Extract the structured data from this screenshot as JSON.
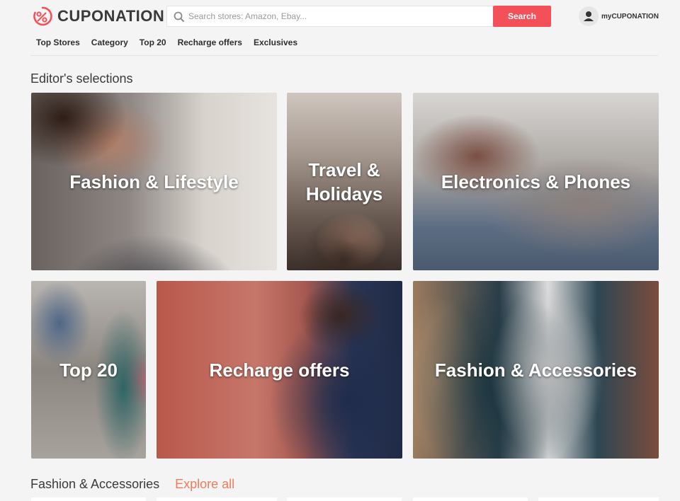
{
  "header": {
    "logo_text": "CUPONATION",
    "search": {
      "placeholder": "Search stores: Amazon, Ebay...",
      "button_label": "Search"
    },
    "account_label": "myCUPONATION"
  },
  "nav": {
    "items": [
      {
        "label": "Top Stores"
      },
      {
        "label": "Category"
      },
      {
        "label": "Top 20"
      },
      {
        "label": "Recharge offers"
      },
      {
        "label": "Exclusives"
      }
    ]
  },
  "editors": {
    "title": "Editor's selections",
    "tiles": [
      {
        "label": "Fashion & Lifestyle",
        "icon": "woman-photo"
      },
      {
        "label": "Travel & Holidays",
        "icon": "camera-photo"
      },
      {
        "label": "Electronics & Phones",
        "icon": "hands-device-photo"
      },
      {
        "label": "Top 20",
        "icon": "clothes-flatlay-photo"
      },
      {
        "label": "Recharge offers",
        "icon": "phone-user-photo"
      },
      {
        "label": "Fashion & Accessories",
        "icon": "jacket-photo"
      }
    ]
  },
  "fashion_section": {
    "title": "Fashion & Accessories",
    "explore_label": "Explore all"
  },
  "colors": {
    "brand": "#f4505a",
    "accent_link": "#f07a5c",
    "background": "#f4f4f4"
  }
}
